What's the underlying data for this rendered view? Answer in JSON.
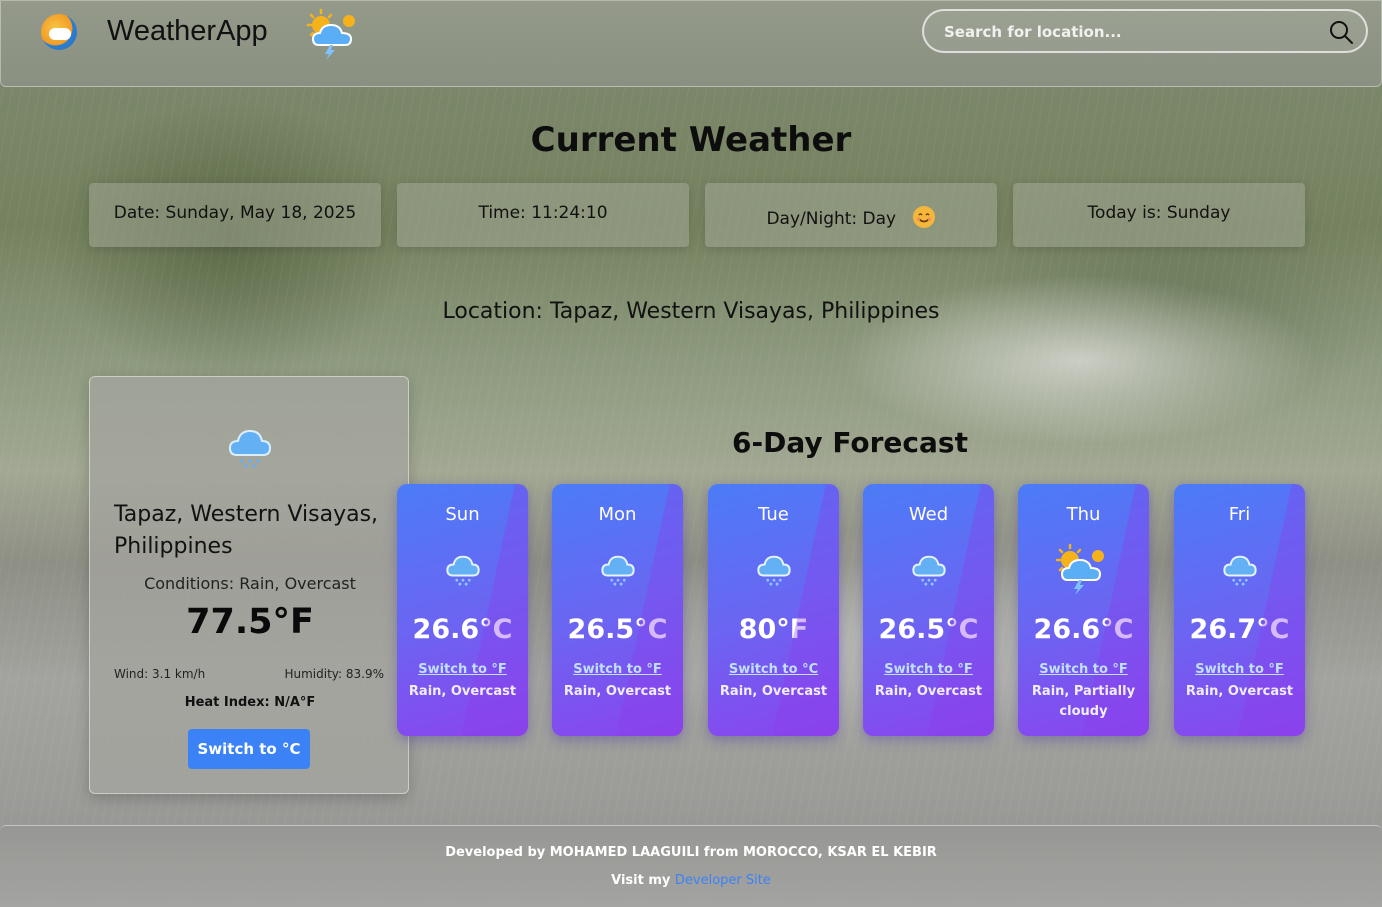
{
  "header": {
    "app_title": "WeatherApp",
    "search_placeholder": "Search for location..."
  },
  "current": {
    "section_title": "Current Weather",
    "date": "Date: Sunday, May 18, 2025",
    "time": "Time: 11:24:10",
    "day_night": "Day/Night: Day",
    "today": "Today is: Sunday",
    "location_line": "Location: Tapaz, Western Visayas, Philippines"
  },
  "main_card": {
    "location": "Tapaz, Western Visayas, Philippines",
    "conditions": "Conditions: Rain, Overcast",
    "temperature": "77.5°F",
    "wind": "Wind: 3.1 km/h",
    "humidity": "Humidity: 83.9%",
    "heat_index": "Heat Index: N/A°F",
    "switch_label": "Switch to °C"
  },
  "forecast": {
    "section_title": "6-Day Forecast",
    "days": [
      {
        "day": "Sun",
        "temp": "26.6°C",
        "switch": "Switch to °F",
        "condition": "Rain, Overcast",
        "icon": "rain-cloud-icon"
      },
      {
        "day": "Mon",
        "temp": "26.5°C",
        "switch": "Switch to °F",
        "condition": "Rain, Overcast",
        "icon": "rain-cloud-icon"
      },
      {
        "day": "Tue",
        "temp": "80°F",
        "switch": "Switch to °C",
        "condition": "Rain, Overcast",
        "icon": "rain-cloud-icon"
      },
      {
        "day": "Wed",
        "temp": "26.5°C",
        "switch": "Switch to °F",
        "condition": "Rain, Overcast",
        "icon": "rain-cloud-icon"
      },
      {
        "day": "Thu",
        "temp": "26.6°C",
        "switch": "Switch to °F",
        "condition": "Rain, Partially cloudy",
        "icon": "sun-thunder-cloud-icon"
      },
      {
        "day": "Fri",
        "temp": "26.7°C",
        "switch": "Switch to °F",
        "condition": "Rain, Overcast",
        "icon": "rain-cloud-icon"
      }
    ]
  },
  "footer": {
    "developer": "Developed by MOHAMED LAAGUILI from MOROCCO, KSAR EL KEBIR",
    "visit_prefix": "Visit my",
    "link_text": "Developer Site"
  },
  "colors": {
    "accent_blue": "#3b82f6",
    "card_gradient_start": "#4b7cf7",
    "card_gradient_end": "#8b44ee"
  }
}
